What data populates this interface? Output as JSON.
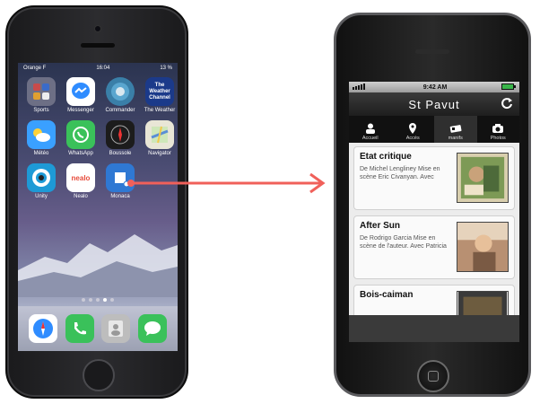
{
  "left_phone": {
    "status": {
      "carrier": "Orange F",
      "time": "16:04",
      "battery": "13 %"
    },
    "apps": [
      {
        "label": "Sports",
        "icon": "sports-icon",
        "color": "#6d6f85"
      },
      {
        "label": "Messenger",
        "icon": "messenger-icon",
        "color": "#2f8cff"
      },
      {
        "label": "Commander",
        "icon": "commander-icon",
        "color": "#3a7fa8"
      },
      {
        "label": "The Weather",
        "icon": "weather-channel-icon",
        "color": "#1b3a8a",
        "text": "The Weather Channel"
      },
      {
        "label": "Météo",
        "icon": "weather-icon",
        "color": "#3aa0ff"
      },
      {
        "label": "WhatsApp",
        "icon": "whatsapp-icon",
        "color": "#3ac15a"
      },
      {
        "label": "Boussole",
        "icon": "compass-icon",
        "color": "#1c1c1c"
      },
      {
        "label": "Navigator",
        "icon": "navigator-icon",
        "color": "#e9e6d6"
      },
      {
        "label": "Unity",
        "icon": "unity-icon",
        "color": "#1e9ad6"
      },
      {
        "label": "Nealo",
        "icon": "nealo-icon",
        "color": "#ffffff",
        "text": "nealo"
      },
      {
        "label": "Monaca",
        "icon": "monaca-icon",
        "color": "#2f78d3"
      }
    ],
    "dock": [
      {
        "icon": "safari-icon",
        "color": "#ffffff"
      },
      {
        "icon": "phone-icon",
        "color": "#3ac15a"
      },
      {
        "icon": "contacts-icon",
        "color": "#bdbdbd"
      },
      {
        "icon": "messages-icon",
        "color": "#3ac15a"
      }
    ]
  },
  "right_phone": {
    "status": {
      "time": "9:42 AM"
    },
    "title": "St Pavut",
    "tabs": [
      {
        "label": "Accueil",
        "icon": "person-icon"
      },
      {
        "label": "Accès",
        "icon": "location-pin-icon"
      },
      {
        "label": "manifs",
        "icon": "tickets-icon",
        "selected": true
      },
      {
        "label": "Photos",
        "icon": "camera-icon"
      }
    ],
    "events": [
      {
        "title": "Etat critique",
        "desc": "De Michel Lengliney Mise en scène Eric Civanyan. Avec"
      },
      {
        "title": "After Sun",
        "desc": "De Rodrigo Garcia Mise en scène de l'auteur. Avec Patricia"
      },
      {
        "title": "Bois-caiman",
        "desc": ""
      }
    ]
  },
  "colors": {
    "arrow": "#f0605a"
  }
}
